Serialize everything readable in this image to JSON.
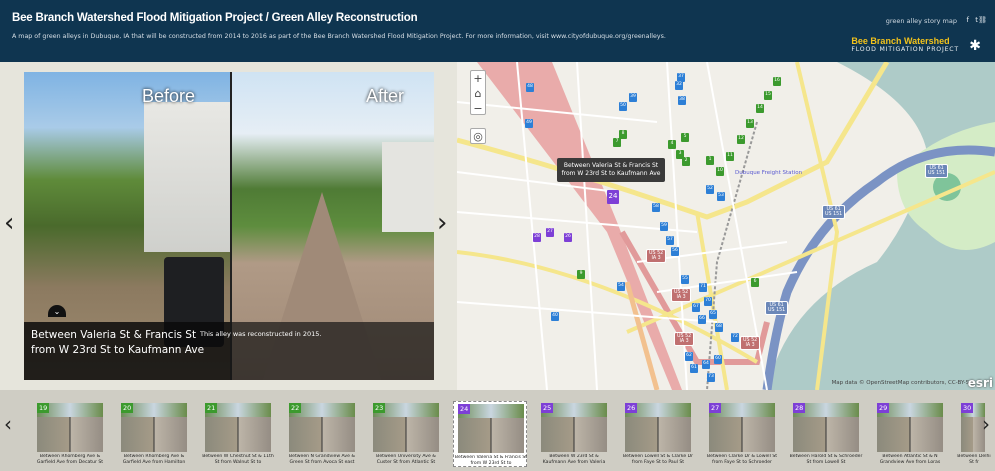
{
  "header": {
    "title": "Bee Branch Watershed Flood Mitigation Project / Green Alley Reconstruction",
    "subtitle": "A map of green alleys in Dubuque, IA that will be constructed from 2014 to 2016 as part of the Bee Branch Watershed Flood Mitigation Project. For more information, visit www.cityofdubuque.org/greenalleys.",
    "story_link": "green alley story map",
    "social": [
      "f",
      "t",
      "link"
    ],
    "logo_line1": "Bee Branch Watershed",
    "logo_line2": "FLOOD MITIGATION PROJECT"
  },
  "story": {
    "before_label": "Before",
    "after_label": "After",
    "title": "Between Valeria St & Francis St from W 23rd St to Kaufmann Ave",
    "description": "This alley was reconstructed in 2015.",
    "prev": "‹",
    "next": "›"
  },
  "map": {
    "zoom_in": "+",
    "home": "⌂",
    "zoom_out": "−",
    "locate": "◎",
    "tooltip": "Between Valeria St & Francis St from W 23rd St to Kaufmann Ave",
    "freight_station": "Dubuque Freight Station",
    "attribution": "Map data © OpenStreetMap contributors, CC-BY-SA",
    "esri": "esri",
    "colors": {
      "green": "#3c9a2e",
      "blue": "#2d7fd6",
      "purple": "#7d3fd6",
      "shield_red": "#c07070",
      "shield_blue": "#6b87b8"
    },
    "markers": [
      {
        "n": "48",
        "c": "blue"
      },
      {
        "n": "50",
        "c": "blue"
      },
      {
        "n": "39",
        "c": "blue"
      },
      {
        "n": "37",
        "c": "blue"
      },
      {
        "n": "32",
        "c": "blue"
      },
      {
        "n": "38",
        "c": "blue"
      },
      {
        "n": "49",
        "c": "blue"
      },
      {
        "n": "8",
        "c": "green"
      },
      {
        "n": "7",
        "c": "green"
      },
      {
        "n": "5",
        "c": "green"
      },
      {
        "n": "4",
        "c": "green"
      },
      {
        "n": "3",
        "c": "green"
      },
      {
        "n": "2",
        "c": "green"
      },
      {
        "n": "16",
        "c": "green"
      },
      {
        "n": "15",
        "c": "green"
      },
      {
        "n": "14",
        "c": "green"
      },
      {
        "n": "13",
        "c": "green"
      },
      {
        "n": "12",
        "c": "green"
      },
      {
        "n": "11",
        "c": "green"
      },
      {
        "n": "1",
        "c": "green"
      },
      {
        "n": "10",
        "c": "green"
      },
      {
        "n": "52",
        "c": "blue"
      },
      {
        "n": "53",
        "c": "blue"
      },
      {
        "n": "24",
        "c": "purple"
      },
      {
        "n": "28",
        "c": "purple"
      },
      {
        "n": "27",
        "c": "purple"
      },
      {
        "n": "26",
        "c": "purple"
      },
      {
        "n": "58",
        "c": "blue"
      },
      {
        "n": "59",
        "c": "blue"
      },
      {
        "n": "57",
        "c": "blue"
      },
      {
        "n": "56",
        "c": "blue"
      },
      {
        "n": "9",
        "c": "green"
      },
      {
        "n": "6",
        "c": "green"
      },
      {
        "n": "55",
        "c": "blue"
      },
      {
        "n": "54",
        "c": "blue"
      },
      {
        "n": "71",
        "c": "blue"
      },
      {
        "n": "70",
        "c": "blue"
      },
      {
        "n": "67",
        "c": "blue"
      },
      {
        "n": "66",
        "c": "blue"
      },
      {
        "n": "65",
        "c": "blue"
      },
      {
        "n": "68",
        "c": "blue"
      },
      {
        "n": "72",
        "c": "blue"
      },
      {
        "n": "40",
        "c": "blue"
      },
      {
        "n": "62",
        "c": "blue"
      },
      {
        "n": "61",
        "c": "blue"
      },
      {
        "n": "64",
        "c": "blue"
      },
      {
        "n": "60",
        "c": "blue"
      },
      {
        "n": "73",
        "c": "blue"
      }
    ],
    "shields": [
      {
        "l1": "US 52",
        "l2": "IA 3",
        "c": "shield_red"
      },
      {
        "l1": "US 52",
        "l2": "IA 3",
        "c": "shield_red"
      },
      {
        "l1": "US 52",
        "l2": "IA 3",
        "c": "shield_red"
      },
      {
        "l1": "US 52",
        "l2": "IA 3",
        "c": "shield_red"
      },
      {
        "l1": "US 61",
        "l2": "US 151",
        "c": "shield_blue"
      },
      {
        "l1": "US 61",
        "l2": "US 151",
        "c": "shield_blue"
      },
      {
        "l1": "US 61",
        "l2": "US 151",
        "c": "shield_blue"
      }
    ]
  },
  "strip": {
    "prev": "‹",
    "next": "›",
    "thumbs": [
      {
        "n": "19",
        "c": "#3c9a2e",
        "cap": "Between Rhomberg Ave & Garfield Ave from Decatur St"
      },
      {
        "n": "20",
        "c": "#3c9a2e",
        "cap": "Between Rhomberg Ave & Garfield Ave from Hamilton"
      },
      {
        "n": "21",
        "c": "#3c9a2e",
        "cap": "Between W Chestnut St & 11th St from Walnut St to"
      },
      {
        "n": "22",
        "c": "#3c9a2e",
        "cap": "Between N Grandview Ave & Green St from Avoca St east"
      },
      {
        "n": "23",
        "c": "#3c9a2e",
        "cap": "Between University Ave & Custer St from Atlantic St"
      },
      {
        "n": "24",
        "c": "#7d3fd6",
        "cap": "Between Valeria St & Francis St from W 23rd St to"
      },
      {
        "n": "25",
        "c": "#7d3fd6",
        "cap": "Between W 23rd St & Kaufmann Ave from Valeria"
      },
      {
        "n": "26",
        "c": "#7d3fd6",
        "cap": "Between Lowell St & Clarke Dr from Faye St to Paul St"
      },
      {
        "n": "27",
        "c": "#7d3fd6",
        "cap": "Between Clarke Dr & Lowell St from Faye St to Schroeder"
      },
      {
        "n": "28",
        "c": "#7d3fd6",
        "cap": "Between Harold St & Schroeder St from Lowell St"
      },
      {
        "n": "29",
        "c": "#7d3fd6",
        "cap": "Between Atlantic St & N Grandview Ave from Loras"
      },
      {
        "n": "30",
        "c": "#7d3fd6",
        "cap": "Between Delhi St fr"
      }
    ]
  }
}
